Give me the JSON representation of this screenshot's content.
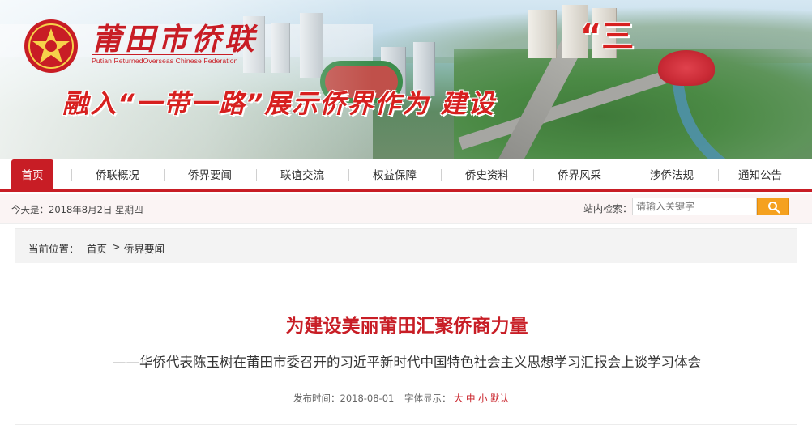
{
  "header": {
    "org_name_cn": "莆田市侨联",
    "org_name_en": "Putian ReturnedOverseas Chinese Federation",
    "slogan": "融入“一带一路”展示侨界作为 建设",
    "slogan_end": "“三"
  },
  "nav": {
    "items": [
      {
        "label": "首页",
        "active": true
      },
      {
        "label": "侨联概况",
        "active": false
      },
      {
        "label": "侨界要闻",
        "active": false
      },
      {
        "label": "联谊交流",
        "active": false
      },
      {
        "label": "权益保障",
        "active": false
      },
      {
        "label": "侨史资料",
        "active": false
      },
      {
        "label": "侨界风采",
        "active": false
      },
      {
        "label": "涉侨法规",
        "active": false
      },
      {
        "label": "通知公告",
        "active": false
      }
    ]
  },
  "infobar": {
    "date": "今天是：2018年8月2日 星期四",
    "search_label": "站内检索：",
    "search_placeholder": "请输入关键字"
  },
  "breadcrumb": {
    "prefix": "当前位置：",
    "home": "首页",
    "sep": ">",
    "current": "侨界要闻"
  },
  "article": {
    "title": "为建设美丽莆田汇聚侨商力量",
    "subtitle": "——华侨代表陈玉树在莆田市委召开的习近平新时代中国特色社会主义思想学习汇报会上谈学习体会",
    "date_label": "发布时间：2018-08-01",
    "font_label": "字体显示：",
    "font_large": "大",
    "font_medium": "中",
    "font_small": "小",
    "font_default": "默认"
  },
  "colors": {
    "brand_red": "#c81d25",
    "search_orange": "#f5a11f"
  }
}
